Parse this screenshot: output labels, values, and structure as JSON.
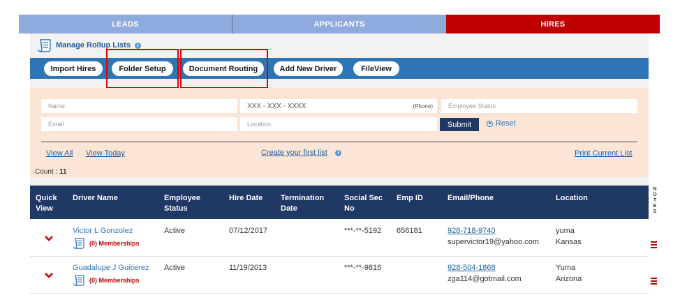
{
  "tabs": {
    "leads": "LEADS",
    "applicants": "APPLICANTS",
    "hires": "HIRES"
  },
  "rollup": {
    "label": "Manage Rollup Lists",
    "info": "i"
  },
  "toolbar": {
    "import_hires": "Import Hires",
    "folder_setup": "Folder Setup",
    "document_routing": "Document Routing",
    "add_new_driver": "Add New Driver",
    "fileview": "FileView"
  },
  "filters": {
    "name_placeholder": "Name",
    "phone_value": "XXX - XXX - XXXX",
    "phone_tag": "(Phone)",
    "employee_status_placeholder": "Employee Status",
    "email_placeholder": "Email",
    "location_placeholder": "Location",
    "submit": "Submit",
    "reset": "Reset"
  },
  "links": {
    "view_all": "View All",
    "view_today": "View Today",
    "create_list": "Create your first list",
    "print_list": "Print Current List"
  },
  "count": {
    "label": "Count : ",
    "value": "11"
  },
  "table": {
    "headers": {
      "quick_view": [
        "Quick",
        "View"
      ],
      "driver_name": [
        "Driver Name",
        ""
      ],
      "employee_status": [
        "Employee",
        "Status"
      ],
      "hire_date": [
        "Hire Date",
        ""
      ],
      "termination_date": [
        "Termination",
        "Date"
      ],
      "ssn": [
        "Social Sec",
        "No"
      ],
      "emp_id": [
        "Emp ID",
        ""
      ],
      "email_phone": [
        "Email/Phone",
        ""
      ],
      "location": [
        "Location",
        ""
      ]
    },
    "rows": [
      {
        "name": "Victor L Gonzolez",
        "memberships": "(0) Memberships",
        "status": "Active",
        "hire_date": "07/12/2017",
        "termination_date": "",
        "ssn": "***-**-5192",
        "emp_id": "656181",
        "phone": "928-718-9740",
        "email": "supervictor19@yahoo.com",
        "city": "yuma",
        "state": "Kansas"
      },
      {
        "name": "Guadalupe J Guitierez",
        "memberships": "(0) Memberships",
        "status": "Active",
        "hire_date": "11/19/2013",
        "termination_date": "",
        "ssn": "***-**-9816",
        "emp_id": "",
        "phone": "928-504-1868",
        "email": "zga114@gotmail.com",
        "city": "Yuma",
        "state": "Arizona"
      }
    ]
  },
  "notes_label": [
    "N",
    "O",
    "T",
    "E",
    "S"
  ],
  "colors": {
    "tab_inactive": "#8faadc",
    "tab_active": "#c00000",
    "toolbar": "#2e75b6",
    "table_header": "#1f3864",
    "filter_bg": "#fbe5d6",
    "highlight": "#e00000"
  }
}
